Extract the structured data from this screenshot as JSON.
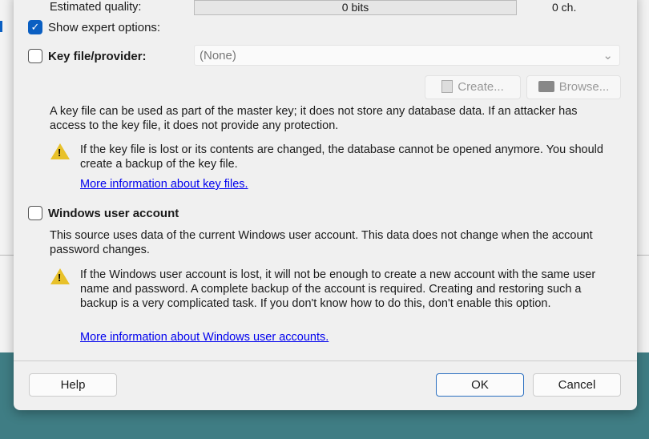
{
  "quality": {
    "label": "Estimated quality:",
    "bits": "0 bits",
    "chars": "0 ch."
  },
  "expert": {
    "label": "Show expert options:",
    "checked": true
  },
  "keyfile": {
    "label": "Key file/provider:",
    "checked": false,
    "select_value": "(None)",
    "create": "Create...",
    "browse": "Browse...",
    "desc": "A key file can be used as part of the master key; it does not store any database data. If an attacker has access to the key file, it does not provide any protection.",
    "warning": "If the key file is lost or its contents are changed, the database cannot be opened anymore. You should create a backup of the key file.",
    "link": "More information about key files."
  },
  "winuser": {
    "label": "Windows user account",
    "checked": false,
    "desc": "This source uses data of the current Windows user account. This data does not change when the account password changes.",
    "warning": "If the Windows user account is lost, it will not be enough to create a new account with the same user name and password. A complete backup of the account is required. Creating and restoring such a backup is a very complicated task. If you don't know how to do this, don't enable this option.",
    "link": "More information about Windows user accounts."
  },
  "buttons": {
    "help": "Help",
    "ok": "OK",
    "cancel": "Cancel"
  }
}
